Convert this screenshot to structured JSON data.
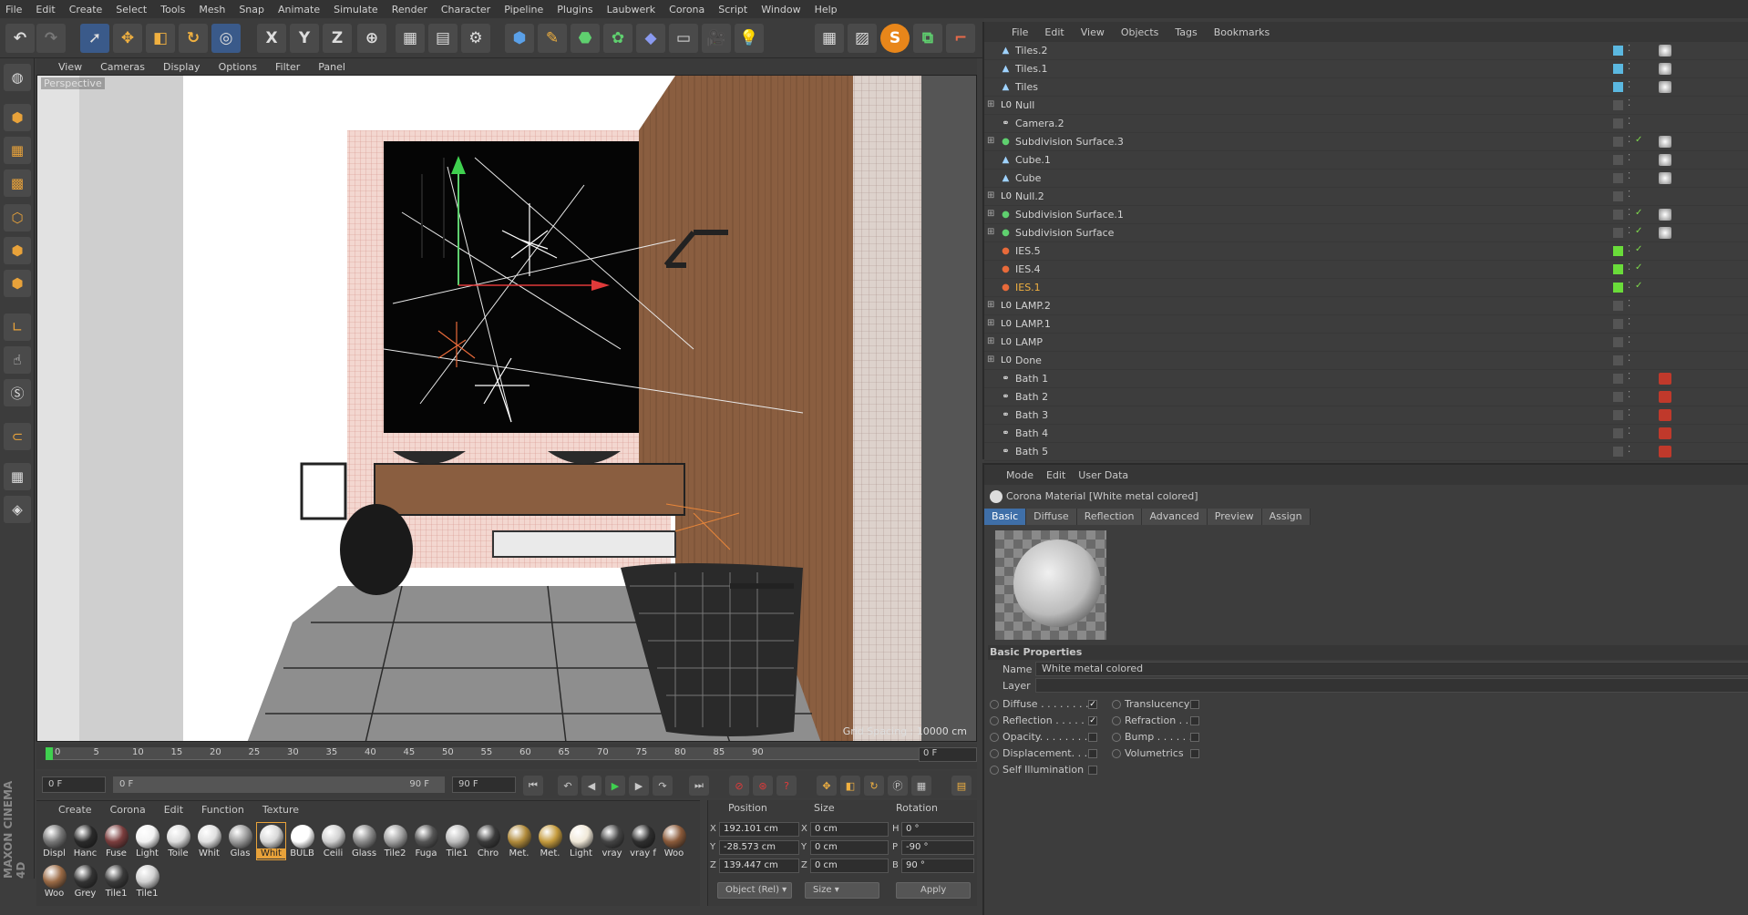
{
  "menubar": [
    "File",
    "Edit",
    "Create",
    "Select",
    "Tools",
    "Mesh",
    "Snap",
    "Animate",
    "Simulate",
    "Render",
    "Character",
    "Pipeline",
    "Plugins",
    "Laubwerk",
    "Corona",
    "Script",
    "Window",
    "Help"
  ],
  "toolbar": {
    "x": "X",
    "y": "Y",
    "z": "Z",
    "s": "S"
  },
  "viewport": {
    "menu": [
      "View",
      "Cameras",
      "Display",
      "Options",
      "Filter",
      "Panel"
    ],
    "label": "Perspective",
    "grid": "Grid Spacing : 10000 cm"
  },
  "timeline": {
    "ticks": [
      "0",
      "5",
      "10",
      "15",
      "20",
      "25",
      "30",
      "35",
      "40",
      "45",
      "50",
      "55",
      "60",
      "65",
      "70",
      "75",
      "80",
      "85",
      "90"
    ],
    "frame": "0 F"
  },
  "playback": {
    "start": "0 F",
    "min": "0 F",
    "max": "90 F",
    "end": "90 F"
  },
  "materials": {
    "menu": [
      "Create",
      "Corona",
      "Edit",
      "Function",
      "Texture"
    ],
    "items": [
      {
        "n": "Displ",
        "c": "#777"
      },
      {
        "n": "Hanc",
        "c": "#2a2a2a"
      },
      {
        "n": "Fuse",
        "c": "#7a3d3d"
      },
      {
        "n": "Light",
        "c": "#f2f2f2"
      },
      {
        "n": "Toile",
        "c": "#dcdcdc"
      },
      {
        "n": "Whit",
        "c": "#e0e0e0"
      },
      {
        "n": "Glas",
        "c": "#9a9a9a"
      },
      {
        "n": "Whit",
        "c": "#d8d8d8"
      },
      {
        "n": "BULB",
        "c": "#ffffff"
      },
      {
        "n": "Ceili",
        "c": "#d0d0d0"
      },
      {
        "n": "Glass",
        "c": "#8a8a8a"
      },
      {
        "n": "Tile2",
        "c": "#a0a0a0"
      },
      {
        "n": "Fuga",
        "c": "#555"
      },
      {
        "n": "Tile1",
        "c": "#bdbdbd"
      },
      {
        "n": "Chro",
        "c": "#3a3a3a"
      },
      {
        "n": "Met.",
        "c": "#b08a3a"
      },
      {
        "n": "Met.",
        "c": "#c49a3c"
      },
      {
        "n": "Light",
        "c": "#f0e8d8"
      },
      {
        "n": "vray",
        "c": "#444"
      },
      {
        "n": "vray f",
        "c": "#2e2e2e"
      },
      {
        "n": "Woo",
        "c": "#8a5a3a"
      },
      {
        "n": "Woo",
        "c": "#9a6a45"
      },
      {
        "n": "Grey",
        "c": "#333"
      },
      {
        "n": "Tile1",
        "c": "#3a3a3a"
      },
      {
        "n": "Tile1",
        "c": "#d0d0d0"
      }
    ]
  },
  "coords": {
    "headers": [
      "Position",
      "Size",
      "Rotation"
    ],
    "rows": [
      {
        "a": "X",
        "p": "192.101 cm",
        "b": "X",
        "s": "0 cm",
        "c": "H",
        "r": "0 °"
      },
      {
        "a": "Y",
        "p": "-28.573 cm",
        "b": "Y",
        "s": "0 cm",
        "c": "P",
        "r": "-90 °"
      },
      {
        "a": "Z",
        "p": "139.447 cm",
        "b": "Z",
        "s": "0 cm",
        "c": "B",
        "r": "90 °"
      }
    ],
    "mode": "Object (Rel)",
    "size": "Size",
    "apply": "Apply"
  },
  "objects": {
    "menu": [
      "File",
      "Edit",
      "View",
      "Objects",
      "Tags",
      "Bookmarks"
    ],
    "rows": [
      {
        "name": "Tiles.2",
        "icon": "cube",
        "layer": "#5bb8e0",
        "exp": ""
      },
      {
        "name": "Tiles.1",
        "icon": "cube",
        "layer": "#5bb8e0",
        "exp": ""
      },
      {
        "name": "Tiles",
        "icon": "cube",
        "layer": "#5bb8e0",
        "exp": ""
      },
      {
        "name": "Null",
        "icon": "null",
        "layer": "",
        "exp": "+"
      },
      {
        "name": "Camera.2",
        "icon": "camera",
        "layer": "",
        "exp": ""
      },
      {
        "name": "Subdivision Surface.3",
        "icon": "subd",
        "layer": "",
        "exp": "+"
      },
      {
        "name": "Cube.1",
        "icon": "cube",
        "layer": "",
        "exp": ""
      },
      {
        "name": "Cube",
        "icon": "cube",
        "layer": "",
        "exp": ""
      },
      {
        "name": "Null.2",
        "icon": "null",
        "layer": "",
        "exp": "+"
      },
      {
        "name": "Subdivision Surface.1",
        "icon": "subd",
        "layer": "",
        "exp": "+"
      },
      {
        "name": "Subdivision Surface",
        "icon": "subd",
        "layer": "",
        "exp": "+"
      },
      {
        "name": "IES.5",
        "icon": "light",
        "layer": "#6adc3a",
        "exp": ""
      },
      {
        "name": "IES.4",
        "icon": "light",
        "layer": "#6adc3a",
        "exp": ""
      },
      {
        "name": "IES.1",
        "icon": "light",
        "layer": "#6adc3a",
        "exp": "",
        "selected": true
      },
      {
        "name": "LAMP.2",
        "icon": "null",
        "layer": "",
        "exp": "+"
      },
      {
        "name": "LAMP.1",
        "icon": "null",
        "layer": "",
        "exp": "+"
      },
      {
        "name": "LAMP",
        "icon": "null",
        "layer": "",
        "exp": "+"
      },
      {
        "name": "Done",
        "icon": "null",
        "layer": "",
        "exp": "+"
      },
      {
        "name": "Bath 1",
        "icon": "camera",
        "layer": "",
        "exp": ""
      },
      {
        "name": "Bath 2",
        "icon": "camera",
        "layer": "",
        "exp": ""
      },
      {
        "name": "Bath 3",
        "icon": "camera",
        "layer": "",
        "exp": ""
      },
      {
        "name": "Bath 4",
        "icon": "camera",
        "layer": "",
        "exp": ""
      },
      {
        "name": "Bath 5",
        "icon": "camera",
        "layer": "",
        "exp": ""
      }
    ]
  },
  "attributes": {
    "menu": [
      "Mode",
      "Edit",
      "User Data"
    ],
    "title": "Corona Material [White metal colored]",
    "tabs": [
      "Basic",
      "Diffuse",
      "Reflection",
      "Advanced",
      "Preview",
      "Assign"
    ],
    "section": "Basic Properties",
    "name_label": "Name",
    "name_value": "White metal colored",
    "layer_label": "Layer",
    "left": [
      {
        "l": "Diffuse . . . . . . . .",
        "c": true
      },
      {
        "l": "Reflection . . . . .",
        "c": true
      },
      {
        "l": "Opacity. . . . . . . .",
        "c": false
      },
      {
        "l": "Displacement. . . .",
        "c": false
      },
      {
        "l": "Self Illumination",
        "c": false
      }
    ],
    "right": [
      {
        "l": "Translucency",
        "c": false
      },
      {
        "l": "Refraction . .",
        "c": false
      },
      {
        "l": "Bump . . . . . .",
        "c": false
      },
      {
        "l": "Volumetrics",
        "c": false
      }
    ]
  }
}
